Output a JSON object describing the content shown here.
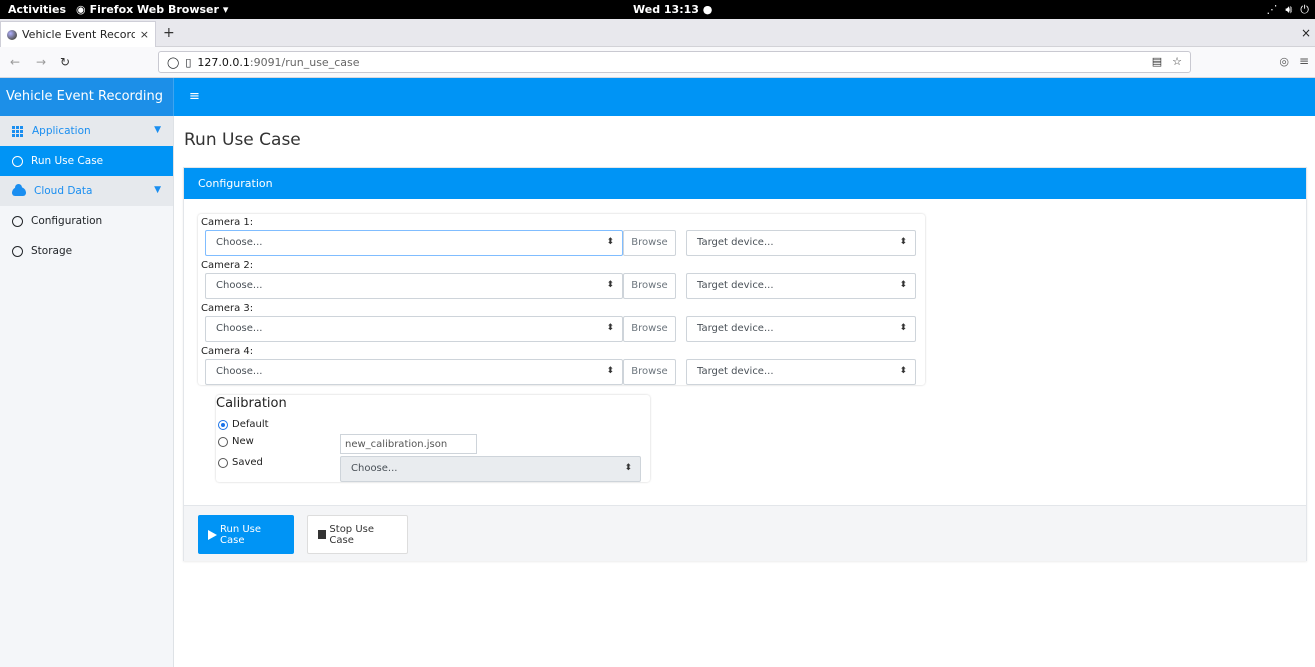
{
  "os_bar": {
    "activities": "Activities",
    "app_name": "Firefox Web Browser",
    "app_caret": "▾",
    "clock": "Wed 13:13",
    "clock_dot": "●"
  },
  "browser": {
    "tab_title": "Vehicle Event Recordin",
    "tab_close": "×",
    "new_tab": "+",
    "window_close": "×",
    "url_host": "127.0.0.1",
    "url_path": ":9091/run_use_case"
  },
  "app": {
    "brand": "Vehicle Event Recording",
    "menu_icon": "≡"
  },
  "sidebar": {
    "items": [
      {
        "label": "Application",
        "kind": "group"
      },
      {
        "label": "Run Use Case",
        "kind": "active"
      },
      {
        "label": "Cloud Data",
        "kind": "group"
      },
      {
        "label": "Configuration",
        "kind": "item"
      },
      {
        "label": "Storage",
        "kind": "item"
      }
    ]
  },
  "main": {
    "page_title": "Run Use Case",
    "card_title": "Configuration",
    "cameras": [
      {
        "label": "Camera 1:",
        "source": "Choose...",
        "browse": "Browse",
        "target": "Target device..."
      },
      {
        "label": "Camera 2:",
        "source": "Choose...",
        "browse": "Browse",
        "target": "Target device..."
      },
      {
        "label": "Camera 3:",
        "source": "Choose...",
        "browse": "Browse",
        "target": "Target device..."
      },
      {
        "label": "Camera 4:",
        "source": "Choose...",
        "browse": "Browse",
        "target": "Target device..."
      }
    ],
    "calibration": {
      "title": "Calibration",
      "options": [
        "Default",
        "New",
        "Saved"
      ],
      "selected": "Default",
      "new_file": "new_calibration.json",
      "saved_select": "Choose..."
    },
    "buttons": {
      "run": "Run Use Case",
      "stop": "Stop Use Case"
    }
  },
  "colors": {
    "accent": "#0094f5",
    "sidebar_bg": "#f4f6f9"
  }
}
